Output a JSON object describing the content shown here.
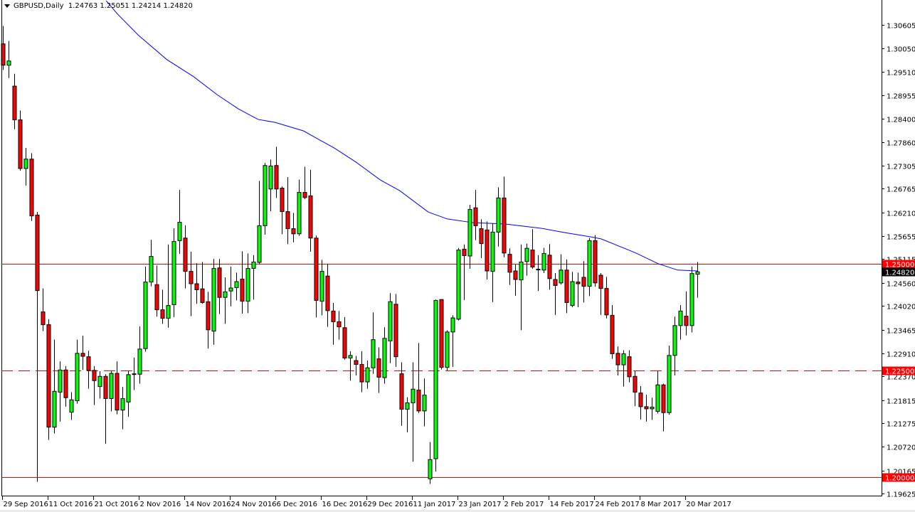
{
  "header": {
    "symbol_timeframe": "GBPUSD,Daily",
    "ohlc": "1.24763 1.25051 1.24214 1.24820"
  },
  "colors": {
    "bull": "#00ff00",
    "bear": "#ff0000",
    "outline": "#000000",
    "ma": "#0000ff",
    "level": "#ff0000",
    "current_bg": "#000000"
  },
  "chart_data": {
    "type": "candlestick",
    "title": "GBPUSD,Daily",
    "ylim": [
      1.19625,
      1.30605
    ],
    "grid": false,
    "y_ticks": [
      "1.30605",
      "1.30050",
      "1.29510",
      "1.28955",
      "1.28400",
      "1.27860",
      "1.27305",
      "1.26765",
      "1.26210",
      "1.25655",
      "1.25115",
      "1.24560",
      "1.24020",
      "1.23465",
      "1.22910",
      "1.22370",
      "1.21815",
      "1.21275",
      "1.20720",
      "1.20165",
      "1.19625"
    ],
    "x_ticks": [
      {
        "bar": 0,
        "label": "29 Sep 2016"
      },
      {
        "bar": 8,
        "label": "11 Oct 2016"
      },
      {
        "bar": 16,
        "label": "21 Oct 2016"
      },
      {
        "bar": 24,
        "label": "2 Nov 2016"
      },
      {
        "bar": 32,
        "label": "14 Nov 2016"
      },
      {
        "bar": 40,
        "label": "24 Nov 2016"
      },
      {
        "bar": 48,
        "label": "6 Dec 2016"
      },
      {
        "bar": 56,
        "label": "16 Dec 2016"
      },
      {
        "bar": 64,
        "label": "29 Dec 2016"
      },
      {
        "bar": 72,
        "label": "11 Jan 2017"
      },
      {
        "bar": 80,
        "label": "23 Jan 2017"
      },
      {
        "bar": 88,
        "label": "2 Feb 2017"
      },
      {
        "bar": 96,
        "label": "14 Feb 2017"
      },
      {
        "bar": 104,
        "label": "24 Feb 2017"
      },
      {
        "bar": 112,
        "label": "8 Mar 2017"
      },
      {
        "bar": 120,
        "label": "20 Mar 2017"
      }
    ],
    "ohlc_fields": [
      "open",
      "high",
      "low",
      "close"
    ],
    "candles": [
      [
        1.3016,
        1.3058,
        1.2955,
        1.2966
      ],
      [
        1.2966,
        1.3023,
        1.2936,
        1.2976
      ],
      [
        1.2917,
        1.2946,
        1.2816,
        1.2838
      ],
      [
        1.2838,
        1.286,
        1.2719,
        1.2724
      ],
      [
        1.2724,
        1.2772,
        1.2684,
        1.2746
      ],
      [
        1.2746,
        1.276,
        1.2601,
        1.2613
      ],
      [
        1.2615,
        1.2622,
        1.199,
        1.2438
      ],
      [
        1.2388,
        1.2443,
        1.2343,
        1.2358
      ],
      [
        1.2358,
        1.2371,
        1.2088,
        1.2118
      ],
      [
        1.2118,
        1.2323,
        1.2103,
        1.2202
      ],
      [
        1.22,
        1.2272,
        1.2131,
        1.2252
      ],
      [
        1.2252,
        1.2261,
        1.2166,
        1.2187
      ],
      [
        1.2153,
        1.22,
        1.2135,
        1.2182
      ],
      [
        1.218,
        1.2323,
        1.2173,
        1.2291
      ],
      [
        1.2291,
        1.2332,
        1.2252,
        1.2284
      ],
      [
        1.2283,
        1.2297,
        1.2208,
        1.2251
      ],
      [
        1.2251,
        1.2261,
        1.217,
        1.2227
      ],
      [
        1.2213,
        1.2249,
        1.2185,
        1.2237
      ],
      [
        1.2237,
        1.2242,
        1.2079,
        1.2185
      ],
      [
        1.2185,
        1.2249,
        1.2155,
        1.2244
      ],
      [
        1.2244,
        1.2272,
        1.2148,
        1.2158
      ],
      [
        1.2158,
        1.2212,
        1.2113,
        1.2185
      ],
      [
        1.2177,
        1.2249,
        1.2142,
        1.2241
      ],
      [
        1.2242,
        1.2281,
        1.2205,
        1.2243
      ],
      [
        1.2242,
        1.2354,
        1.222,
        1.2301
      ],
      [
        1.2302,
        1.2494,
        1.2295,
        1.2458
      ],
      [
        1.2458,
        1.2557,
        1.2448,
        1.2518
      ],
      [
        1.2452,
        1.2497,
        1.2377,
        1.2393
      ],
      [
        1.2393,
        1.244,
        1.236,
        1.2373
      ],
      [
        1.2373,
        1.2546,
        1.2351,
        1.2403
      ],
      [
        1.2405,
        1.2584,
        1.2376,
        1.2553
      ],
      [
        1.2555,
        1.2674,
        1.2524,
        1.2598
      ],
      [
        1.2561,
        1.2591,
        1.2443,
        1.2483
      ],
      [
        1.2483,
        1.2529,
        1.2378,
        1.2454
      ],
      [
        1.2454,
        1.2502,
        1.2407,
        1.244
      ],
      [
        1.2442,
        1.2505,
        1.2407,
        1.241
      ],
      [
        1.2412,
        1.2435,
        1.2302,
        1.2346
      ],
      [
        1.2343,
        1.2512,
        1.2311,
        1.249
      ],
      [
        1.2491,
        1.2512,
        1.2383,
        1.2422
      ],
      [
        1.2422,
        1.2469,
        1.236,
        1.2435
      ],
      [
        1.2437,
        1.2494,
        1.2401,
        1.2444
      ],
      [
        1.2445,
        1.248,
        1.2415,
        1.2459
      ],
      [
        1.2465,
        1.253,
        1.2384,
        1.2413
      ],
      [
        1.2413,
        1.2525,
        1.2385,
        1.249
      ],
      [
        1.249,
        1.2521,
        1.2417,
        1.2505
      ],
      [
        1.2504,
        1.2695,
        1.25,
        1.259
      ],
      [
        1.259,
        1.2737,
        1.2569,
        1.2731
      ],
      [
        1.2676,
        1.2745,
        1.2624,
        1.273
      ],
      [
        1.2731,
        1.2775,
        1.2655,
        1.2676
      ],
      [
        1.2678,
        1.2682,
        1.257,
        1.2623
      ],
      [
        1.2623,
        1.2704,
        1.2547,
        1.2583
      ],
      [
        1.2583,
        1.262,
        1.2551,
        1.2571
      ],
      [
        1.2571,
        1.2698,
        1.2566,
        1.2668
      ],
      [
        1.2668,
        1.2728,
        1.2652,
        1.2656
      ],
      [
        1.266,
        1.2721,
        1.2529,
        1.2561
      ],
      [
        1.2561,
        1.2567,
        1.2375,
        1.2415
      ],
      [
        1.2413,
        1.251,
        1.238,
        1.2483
      ],
      [
        1.2472,
        1.2501,
        1.2353,
        1.2391
      ],
      [
        1.239,
        1.2409,
        1.2311,
        1.2365
      ],
      [
        1.2365,
        1.239,
        1.2323,
        1.2353
      ],
      [
        1.2351,
        1.2376,
        1.2276,
        1.228
      ],
      [
        1.228,
        1.2296,
        1.2227,
        1.2286
      ],
      [
        1.2274,
        1.2285,
        1.2239,
        1.2265
      ],
      [
        1.2265,
        1.2296,
        1.22,
        1.2224
      ],
      [
        1.2224,
        1.2274,
        1.2208,
        1.2257
      ],
      [
        1.2257,
        1.2387,
        1.2243,
        1.2323
      ],
      [
        1.2278,
        1.2305,
        1.2198,
        1.2235
      ],
      [
        1.2234,
        1.2352,
        1.222,
        1.2326
      ],
      [
        1.232,
        1.2432,
        1.2268,
        1.2412
      ],
      [
        1.2406,
        1.243,
        1.2259,
        1.2283
      ],
      [
        1.2243,
        1.227,
        1.2121,
        1.216
      ],
      [
        1.216,
        1.2188,
        1.2106,
        1.2175
      ],
      [
        1.2175,
        1.227,
        1.2037,
        1.2207
      ],
      [
        1.2205,
        1.2315,
        1.2151,
        1.2156
      ],
      [
        1.2156,
        1.2232,
        1.212,
        1.2193
      ],
      [
        1.1997,
        1.2083,
        1.1985,
        1.2042
      ],
      [
        1.2044,
        1.2417,
        1.2014,
        1.2415
      ],
      [
        1.2417,
        1.2417,
        1.2253,
        1.2258
      ],
      [
        1.2258,
        1.2345,
        1.2251,
        1.2341
      ],
      [
        1.2341,
        1.238,
        1.2259,
        1.2374
      ],
      [
        1.2371,
        1.2538,
        1.2368,
        1.2533
      ],
      [
        1.2535,
        1.2546,
        1.2416,
        1.252
      ],
      [
        1.2519,
        1.2639,
        1.2489,
        1.2628
      ],
      [
        1.2632,
        1.2674,
        1.2556,
        1.259
      ],
      [
        1.2583,
        1.2605,
        1.2514,
        1.2548
      ],
      [
        1.258,
        1.26,
        1.2464,
        1.2484
      ],
      [
        1.2483,
        1.2595,
        1.2411,
        1.2575
      ],
      [
        1.2575,
        1.268,
        1.2541,
        1.2655
      ],
      [
        1.2655,
        1.2705,
        1.2516,
        1.2526
      ],
      [
        1.2523,
        1.2537,
        1.2451,
        1.2481
      ],
      [
        1.2484,
        1.2499,
        1.2426,
        1.2464
      ],
      [
        1.2463,
        1.2546,
        1.2345,
        1.2505
      ],
      [
        1.2506,
        1.2548,
        1.2473,
        1.2537
      ],
      [
        1.2533,
        1.2582,
        1.2489,
        1.2493
      ],
      [
        1.2487,
        1.2521,
        1.2437,
        1.2488
      ],
      [
        1.2486,
        1.2538,
        1.2479,
        1.2525
      ],
      [
        1.2521,
        1.2547,
        1.244,
        1.2466
      ],
      [
        1.2464,
        1.2479,
        1.2381,
        1.245
      ],
      [
        1.2456,
        1.2523,
        1.2452,
        1.2486
      ],
      [
        1.2486,
        1.2511,
        1.2385,
        1.241
      ],
      [
        1.2403,
        1.2482,
        1.2399,
        1.2459
      ],
      [
        1.2458,
        1.248,
        1.2399,
        1.2454
      ],
      [
        1.2469,
        1.2507,
        1.241,
        1.2448
      ],
      [
        1.2448,
        1.2561,
        1.2425,
        1.2555
      ],
      [
        1.2555,
        1.2568,
        1.2447,
        1.2456
      ],
      [
        1.2474,
        1.2479,
        1.2381,
        1.2443
      ],
      [
        1.2443,
        1.247,
        1.2373,
        1.2381
      ],
      [
        1.238,
        1.2404,
        1.2278,
        1.229
      ],
      [
        1.2291,
        1.2307,
        1.2239,
        1.2264
      ],
      [
        1.2264,
        1.2298,
        1.2213,
        1.229
      ],
      [
        1.2283,
        1.2298,
        1.2223,
        1.2236
      ],
      [
        1.2237,
        1.2249,
        1.2167,
        1.22
      ],
      [
        1.2198,
        1.2214,
        1.2136,
        1.2166
      ],
      [
        1.2166,
        1.2194,
        1.2131,
        1.2161
      ],
      [
        1.2161,
        1.2187,
        1.2135,
        1.2165
      ],
      [
        1.2155,
        1.2249,
        1.215,
        1.2217
      ],
      [
        1.2217,
        1.222,
        1.2108,
        1.2152
      ],
      [
        1.2152,
        1.2309,
        1.2147,
        1.2286
      ],
      [
        1.2286,
        1.2377,
        1.2239,
        1.2356
      ],
      [
        1.2356,
        1.2404,
        1.2323,
        1.239
      ],
      [
        1.2378,
        1.2436,
        1.2333,
        1.2356
      ],
      [
        1.2356,
        1.2494,
        1.234,
        1.2478
      ],
      [
        1.24763,
        1.25051,
        1.24214,
        1.2482
      ]
    ],
    "moving_average": [
      [
        18.1,
        1.3119
      ],
      [
        20.2,
        1.3086
      ],
      [
        23.9,
        1.3036
      ],
      [
        28.9,
        1.2979
      ],
      [
        33.6,
        1.2939
      ],
      [
        37.7,
        1.2897
      ],
      [
        41.4,
        1.2864
      ],
      [
        44.9,
        1.2839
      ],
      [
        47.9,
        1.2832
      ],
      [
        52.9,
        1.2812
      ],
      [
        54.9,
        1.2797
      ],
      [
        58.3,
        1.2772
      ],
      [
        62.1,
        1.2739
      ],
      [
        66.4,
        1.2697
      ],
      [
        69.8,
        1.2672
      ],
      [
        74.8,
        1.2622
      ],
      [
        78.1,
        1.2606
      ],
      [
        82.7,
        1.2597
      ],
      [
        88.3,
        1.2594
      ],
      [
        94.6,
        1.2584
      ],
      [
        98.7,
        1.2574
      ],
      [
        103.3,
        1.2564
      ],
      [
        105.2,
        1.2559
      ],
      [
        111.1,
        1.2527
      ],
      [
        115.2,
        1.2501
      ],
      [
        118.6,
        1.2486
      ],
      [
        122.1,
        1.2484
      ]
    ],
    "levels": [
      {
        "price": 1.25,
        "label": "1.25000",
        "style": "solid"
      },
      {
        "price": 1.225,
        "label": "1.22500",
        "style": "dashed"
      },
      {
        "price": 1.2,
        "label": "1.20000",
        "style": "solid"
      }
    ],
    "current_price": {
      "price": 1.2482,
      "label": "1.24820"
    }
  }
}
